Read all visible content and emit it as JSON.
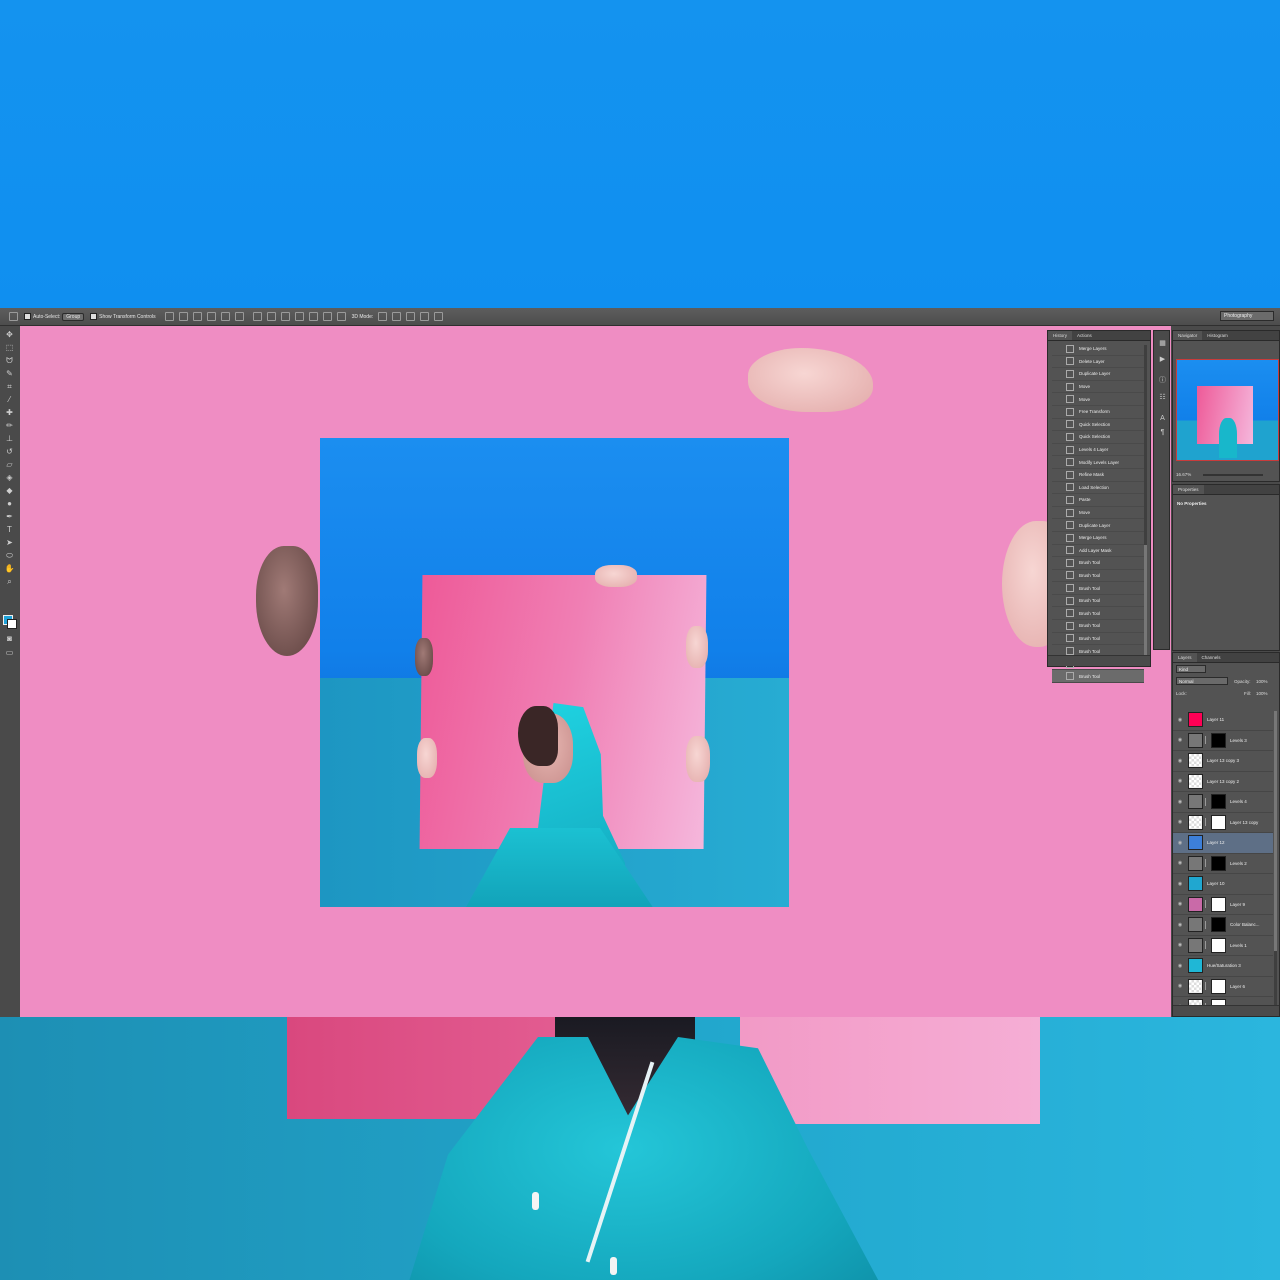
{
  "options_bar": {
    "auto_select_label": "Auto-Select:",
    "auto_select_value": "Group",
    "show_transform_label": "Show Transform Controls",
    "mode_label": "3D Mode:",
    "workspace": "Photography"
  },
  "history_panel": {
    "tabs": [
      "History",
      "Actions"
    ],
    "items": [
      "Merge Layers",
      "Delete Layer",
      "Duplicate Layer",
      "Move",
      "Move",
      "Free Transform",
      "Quick Selection",
      "Quick Selection",
      "Levels 4 Layer",
      "Modify Levels Layer",
      "Refine Mask",
      "Load Selection",
      "Paste",
      "Move",
      "Duplicate Layer",
      "Merge Layers",
      "Add Layer Mask",
      "Brush Tool",
      "Brush Tool",
      "Brush Tool",
      "Brush Tool",
      "Brush Tool",
      "Brush Tool",
      "Brush Tool",
      "Brush Tool",
      "Brush Tool",
      "Brush Tool"
    ]
  },
  "navigator_panel": {
    "tabs": [
      "Navigator",
      "Histogram"
    ],
    "zoom": "16.67%"
  },
  "properties_panel": {
    "tab": "Properties",
    "text": "No Properties"
  },
  "layers_panel": {
    "tabs": [
      "Layers",
      "Channels"
    ],
    "kind_label": "Kind",
    "blend_mode": "Normal",
    "opacity_label": "Opacity:",
    "opacity_value": "100%",
    "lock_label": "Lock:",
    "fill_label": "Fill:",
    "fill_value": "100%",
    "layers": [
      {
        "name": "Layer 11",
        "selected": false
      },
      {
        "name": "Levels 3",
        "selected": false
      },
      {
        "name": "Layer 13 copy 3",
        "selected": false
      },
      {
        "name": "Layer 13 copy 2",
        "selected": false
      },
      {
        "name": "Levels 4",
        "selected": false
      },
      {
        "name": "Layer 13 copy",
        "selected": false
      },
      {
        "name": "Layer 12",
        "selected": true
      },
      {
        "name": "Levels 2",
        "selected": false
      },
      {
        "name": "Layer 10",
        "selected": false
      },
      {
        "name": "Layer 9",
        "selected": false
      },
      {
        "name": "Color Balanc...",
        "selected": false
      },
      {
        "name": "Levels 1",
        "selected": false
      },
      {
        "name": "Hue/Saturation 3",
        "selected": false
      },
      {
        "name": "Layer 6",
        "selected": false
      },
      {
        "name": "Layer 4",
        "selected": false
      }
    ]
  },
  "colors": {
    "foreground": "#1ea1d8",
    "background": "#ffffff",
    "canvas_pink": "#ef8dc3",
    "sky_blue": "#1190ee"
  }
}
